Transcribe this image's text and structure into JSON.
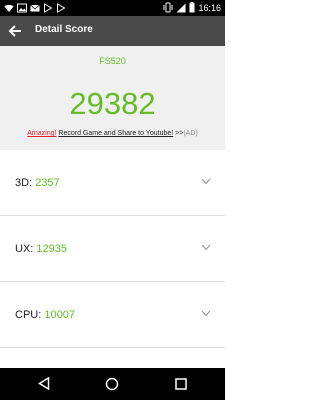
{
  "status_bar": {
    "time": "16:16",
    "icons_left": [
      "wifi-icon",
      "image-icon",
      "mail-icon",
      "play-store-icon",
      "play-store-icon"
    ],
    "icons_right": [
      "vibrate-icon",
      "signal-icon",
      "battery-icon"
    ]
  },
  "app_bar": {
    "title": "Detail Score"
  },
  "score": {
    "device": "FS520",
    "total": "29382",
    "promo_amazing": "Amazing!",
    "promo_link": "Record Game and Share to Youtube!",
    "promo_suffix": ">>",
    "promo_ad": "(AD)"
  },
  "rows": [
    {
      "label": "3D: ",
      "value": "2357"
    },
    {
      "label": "UX: ",
      "value": "12935"
    },
    {
      "label": "CPU: ",
      "value": "10007"
    }
  ],
  "colors": {
    "accent_green": "#66bb2a",
    "app_bar": "#4a4a4a",
    "promo_red": "#d9262b"
  }
}
